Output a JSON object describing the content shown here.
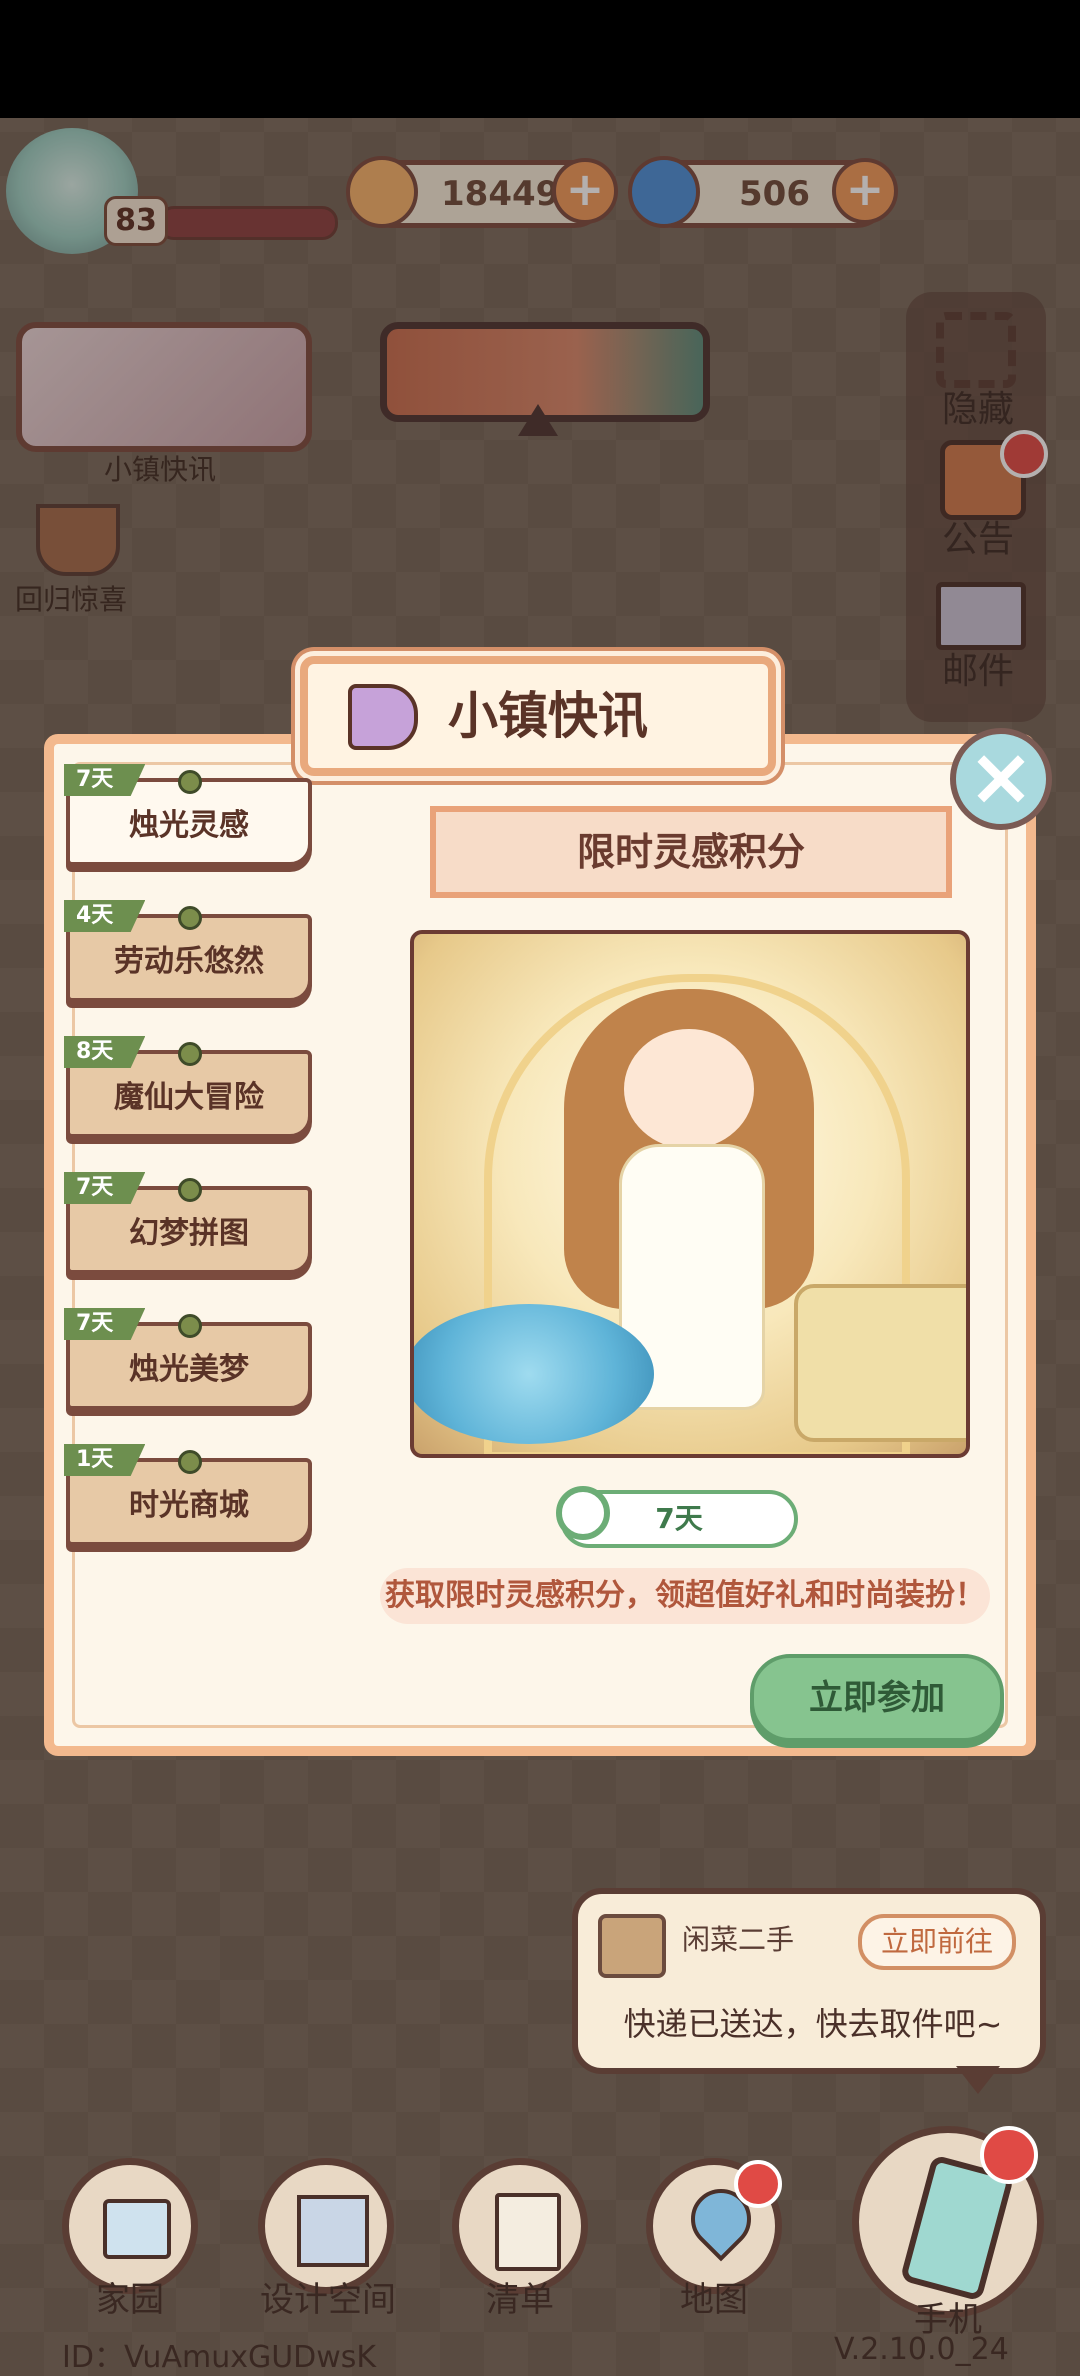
{
  "hud": {
    "level": "83",
    "coins": "18449",
    "gems": "506",
    "coin_color": "#f6b36b",
    "gem_color": "#4a90d9"
  },
  "left_menu": {
    "town_news_label": "小镇快讯",
    "return_surprise_label": "回归惊喜"
  },
  "side_menu": {
    "hide_label": "隐藏",
    "notice_label": "公告",
    "mail_label": "邮件"
  },
  "dialog": {
    "title": "小镇快讯",
    "tabs": [
      {
        "badge": "7天",
        "label": "烛光灵感"
      },
      {
        "badge": "4天",
        "label": "劳动乐悠然"
      },
      {
        "badge": "8天",
        "label": "魔仙大冒险"
      },
      {
        "badge": "7天",
        "label": "幻梦拼图"
      },
      {
        "badge": "7天",
        "label": "烛光美梦"
      },
      {
        "badge": "1天",
        "label": "时光商城"
      }
    ],
    "content_title": "限时灵感积分",
    "timer": "7天",
    "description": "获取限时灵感积分，领超值好礼和时尚装扮！",
    "join_label": "立即参加"
  },
  "notification": {
    "sender": "闲菜二手",
    "action": "立即前往",
    "message": "快递已送达，快去取件吧~"
  },
  "nav": {
    "home": "家园",
    "design": "设计空间",
    "list": "清单",
    "map": "地图",
    "phone": "手机"
  },
  "footer": {
    "id": "ID：VuAmuxGUDwsK",
    "version": "V.2.10.0_24"
  }
}
